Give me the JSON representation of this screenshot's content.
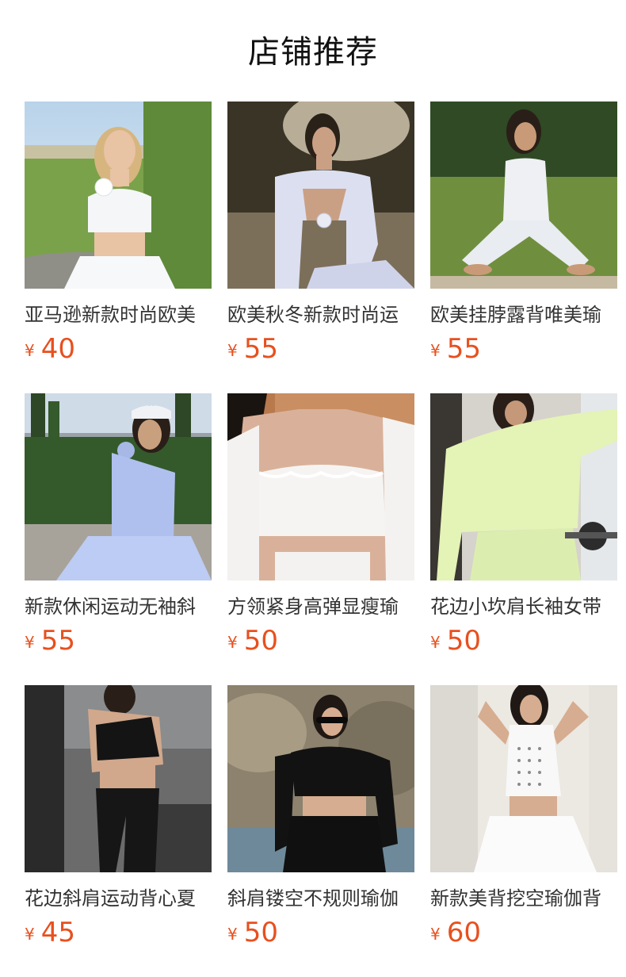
{
  "section": {
    "title": "店铺推荐"
  },
  "currency": "¥",
  "colors": {
    "price": "#e8501e",
    "title": "#111111",
    "name": "#333333"
  },
  "products": [
    {
      "name": "亚马逊新款时尚欧美",
      "price": "40",
      "image": "outdoor-garden-white-one-shoulder-top-photo"
    },
    {
      "name": "欧美秋冬新款时尚运",
      "price": "55",
      "image": "stone-fountain-lavender-wrap-top-photo"
    },
    {
      "name": "欧美挂脖露背唯美瑜",
      "price": "55",
      "image": "lawn-white-halter-yoga-set-photo"
    },
    {
      "name": "新款休闲运动无袖斜",
      "price": "55",
      "image": "cypress-garden-blue-tennis-dress-photo"
    },
    {
      "name": "方领紧身高弹显瘦瑜",
      "price": "50",
      "image": "white-scalloped-long-sleeve-top-photo"
    },
    {
      "name": "花边小坎肩长袖女带",
      "price": "50",
      "image": "gym-mint-scalloped-top-photo"
    },
    {
      "name": "花边斜肩运动背心夏",
      "price": "45",
      "image": "gym-black-one-shoulder-set-photo"
    },
    {
      "name": "斜肩镂空不规则瑜伽",
      "price": "50",
      "image": "rocks-black-long-sleeve-set-photo"
    },
    {
      "name": "新款美背挖空瑜伽背",
      "price": "60",
      "image": "white-studded-tank-tennis-skirt-photo"
    }
  ]
}
